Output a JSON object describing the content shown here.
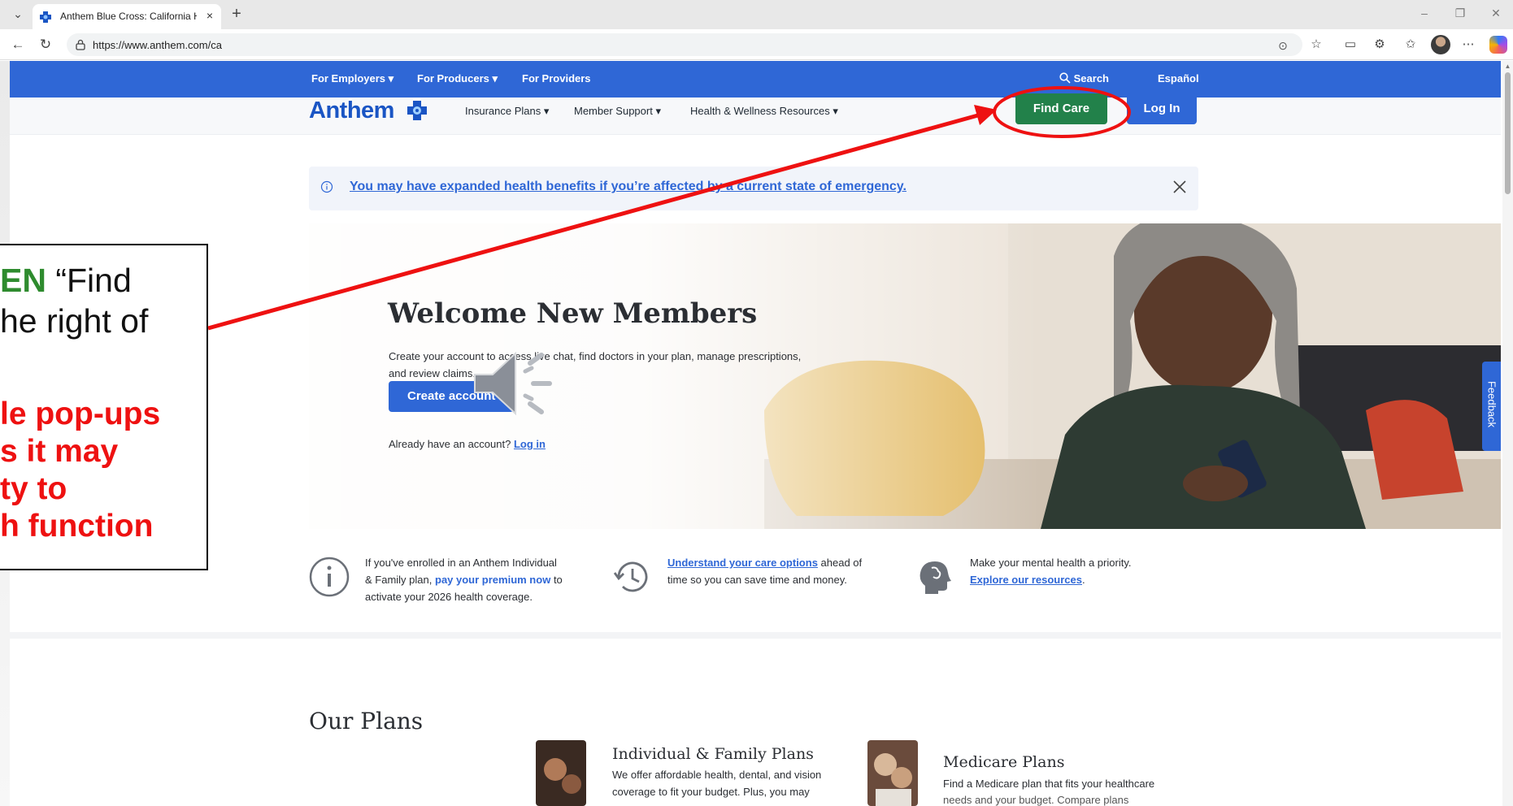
{
  "browser": {
    "tab_title": "Anthem Blue Cross: California He",
    "url": "https://www.anthem.com/ca",
    "new_tab": "+",
    "close": "×"
  },
  "utility_nav": {
    "employers": "For Employers",
    "producers": "For Producers",
    "providers": "For Providers",
    "search": "Search",
    "espanol": "Español"
  },
  "main_nav": {
    "logo": "Anthem",
    "insurance": "Insurance Plans",
    "member_support": "Member Support",
    "wellness": "Health & Wellness Resources",
    "find_care": "Find Care",
    "login": "Log In"
  },
  "alert": {
    "text": "You may have expanded health benefits if you’re affected by a current state of emergency."
  },
  "hero": {
    "title": "Welcome New Members",
    "text": "Create your account to access live chat, find doctors in your plan, manage prescriptions, and review claims.",
    "button": "Create account",
    "login_prompt": "Already have an account?",
    "login_link": "Log in"
  },
  "feedback": "Feedback",
  "info": {
    "item1_a": "If you've enrolled in an Anthem Individual",
    "item1_b": "& Family plan,",
    "item1_link": "pay your premium now",
    "item1_c": "to",
    "item1_d": "activate your 2026 health coverage.",
    "item2_link": "Understand your care options",
    "item2_a": "ahead of",
    "item2_b": "time so you can save time and money.",
    "item3_a": "Make your mental health a priority.",
    "item3_link": "Explore our resources",
    "item3_end": "."
  },
  "plans": {
    "title": "Our Plans",
    "individual_title": "Individual & Family Plans",
    "individual_desc1": "We offer affordable health, dental, and vision",
    "individual_desc2": "coverage to fit your budget. Plus, you may",
    "medicare_title": "Medicare Plans",
    "medicare_desc1": "Find a Medicare plan that fits your healthcare",
    "medicare_desc2": "needs and your budget. Compare plans"
  },
  "callout": {
    "line1_green": "EN",
    "line1_rest": " “Find",
    "line2": "he right of",
    "red1": "le pop-ups",
    "red2": "s it may",
    "red3": "ty to",
    "red4": "h function"
  },
  "colors": {
    "brand_blue": "#2f67d6",
    "find_care_green": "#22814a",
    "annotation_red": "#ee1111"
  }
}
